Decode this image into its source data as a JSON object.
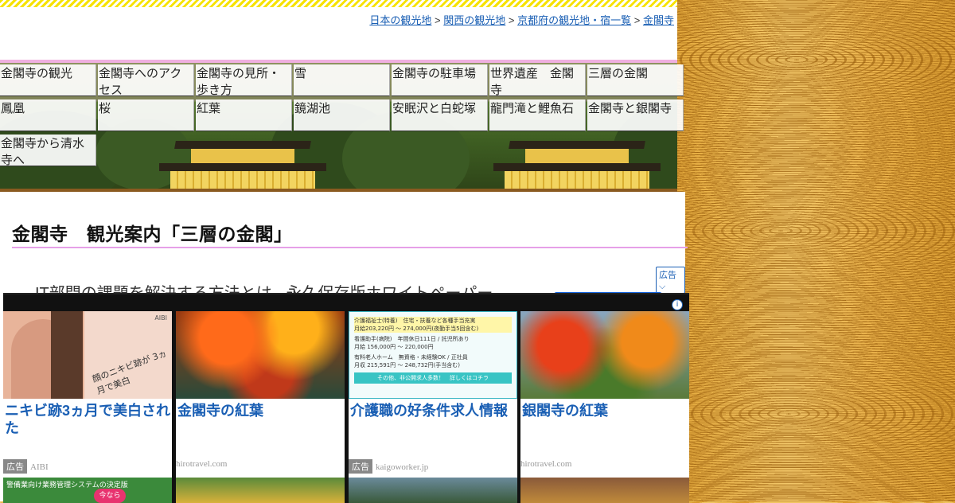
{
  "breadcrumb": {
    "items": [
      "日本の観光地",
      "関西の観光地",
      "京都府の観光地・宿一覧",
      "金閣寺"
    ],
    "separator": ">"
  },
  "nav": {
    "items": [
      "金閣寺の観光",
      "金閣寺へのアクセス",
      "金閣寺の見所・歩き方",
      "雪",
      "金閣寺の駐車場",
      "世界遺産　金閣寺",
      "三層の金閣",
      "鳳凰",
      "桜",
      "紅葉",
      "鏡湖池",
      "安眠沢と白蛇塚",
      "龍門滝と鯉魚石",
      "金閣寺と銀閣寺",
      "金閣寺から清水寺へ"
    ]
  },
  "page": {
    "title": "金閣寺　観光案内「三層の金閣」"
  },
  "ad": {
    "badge": "広告",
    "top_text": "IT部門の課題を解決する方法とは - 永久保存版ホワイトペーパー",
    "info": "i"
  },
  "cards": [
    {
      "title": "ニキビ跡3ヵ月で美白された",
      "source": "AIBI",
      "is_ad": true,
      "ad_label": "広告",
      "thumb_text": "顔のニキビ跡が 3ヵ月で美白",
      "brand": "AIBI"
    },
    {
      "title": "金閣寺の紅葉",
      "source": "hirotravel.com",
      "is_ad": false
    },
    {
      "title": "介護職の好条件求人情報",
      "source": "kaigoworker.jp",
      "is_ad": true,
      "ad_label": "広告",
      "thumb_lines": [
        "介護福祉士(特養)　住宅・扶養など各種手当充実",
        "月給203,220円 〜 274,000円(夜勤手当5回含む)",
        "看護助手(病院)　年間休日111日 / 託児所あり",
        "月給 156,000円 〜 220,000円",
        "有料老人ホーム　無資格・未経験OK / 正社員",
        "月収 215,591円 〜 248,732円(手当含む)",
        "その他、非公開求人多数！　詳しくはコチラ"
      ]
    },
    {
      "title": "銀閣寺の紅葉",
      "source": "hirotravel.com",
      "is_ad": false
    }
  ],
  "next_row": {
    "first_thumb_text": "警備業向け業務管理システムの決定版",
    "first_thumb_badge": "今なら"
  },
  "colors": {
    "link": "#1a5fb4",
    "accent_pink": "#e6a0e8",
    "stripe_yellow": "#f6e200"
  }
}
